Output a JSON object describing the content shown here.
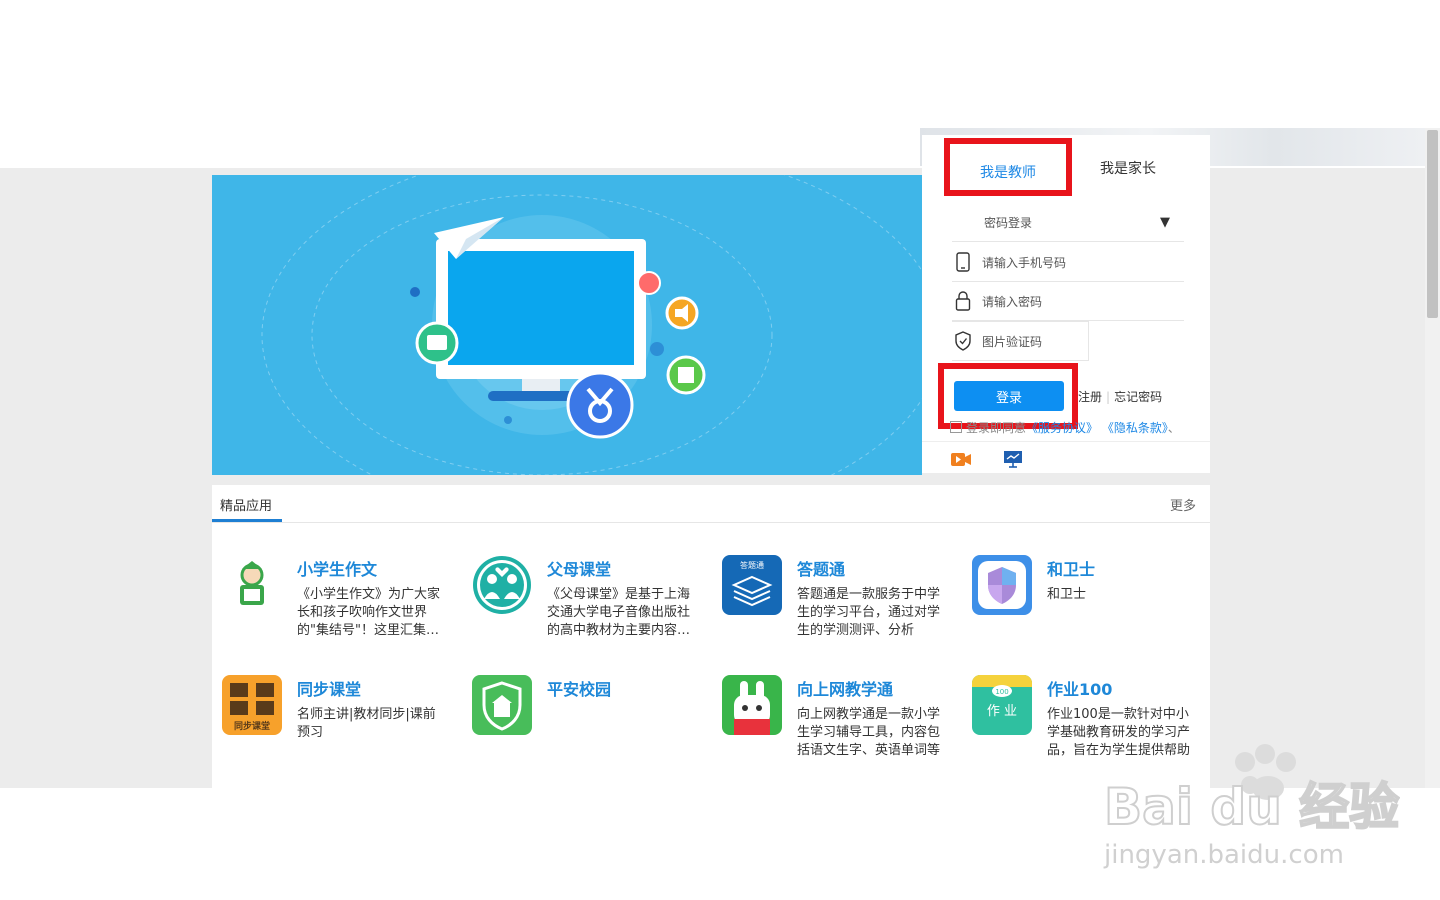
{
  "login": {
    "tab_teacher": "我是教师",
    "tab_parent": "我是家长",
    "mode": "密码登录",
    "phone_placeholder": "请输入手机号码",
    "password_placeholder": "请输入密码",
    "captcha_placeholder": "图片验证码",
    "login_button": "登录",
    "register": "注册",
    "forgot": "忘记密码",
    "agree_prefix": "登录即同意",
    "service_terms": "《服务协议》",
    "privacy_terms": "《隐私条款》",
    "agree_suffix": "、"
  },
  "apps": {
    "title": "精品应用",
    "more": "更多",
    "items": [
      {
        "name": "小学生作文",
        "desc": "《小学生作文》为广大家长和孩子吹响作文世界的\"集结号\"！这里汇集了海量优秀作文"
      },
      {
        "name": "父母课堂",
        "desc": "《父母课堂》是基于上海交通大学电子音像出版社的高中教材为主要内容的产品"
      },
      {
        "name": "答题通",
        "desc": "答题通是一款服务于中学生的学习平台，通过对学生的学测测评、分析"
      },
      {
        "name": "和卫士",
        "desc": "和卫士"
      },
      {
        "name": "同步课堂",
        "desc": "名师主讲|教材同步|课前预习"
      },
      {
        "name": "平安校园",
        "desc": ""
      },
      {
        "name": "向上网教学通",
        "desc": "向上网教学通是一款小学生学习辅导工具，内容包括语文生字、英语单词等"
      },
      {
        "name": "作业100",
        "desc": "作业100是一款针对中小学基础教育研发的学习产品，旨在为学生提供帮助"
      }
    ]
  },
  "icons": {
    "datiTong_label": "答题通",
    "tongbu_label": "同步课堂",
    "zuoye_label": "作 业",
    "zuoye_badge": "100"
  },
  "watermark": {
    "brand": "Bai du 经验",
    "url": "jingyan.baidu.com"
  },
  "colors": {
    "accent": "#1e88e5",
    "highlight": "#e8141b",
    "banner": "#3fb6e8",
    "button": "#0d8ff2"
  }
}
